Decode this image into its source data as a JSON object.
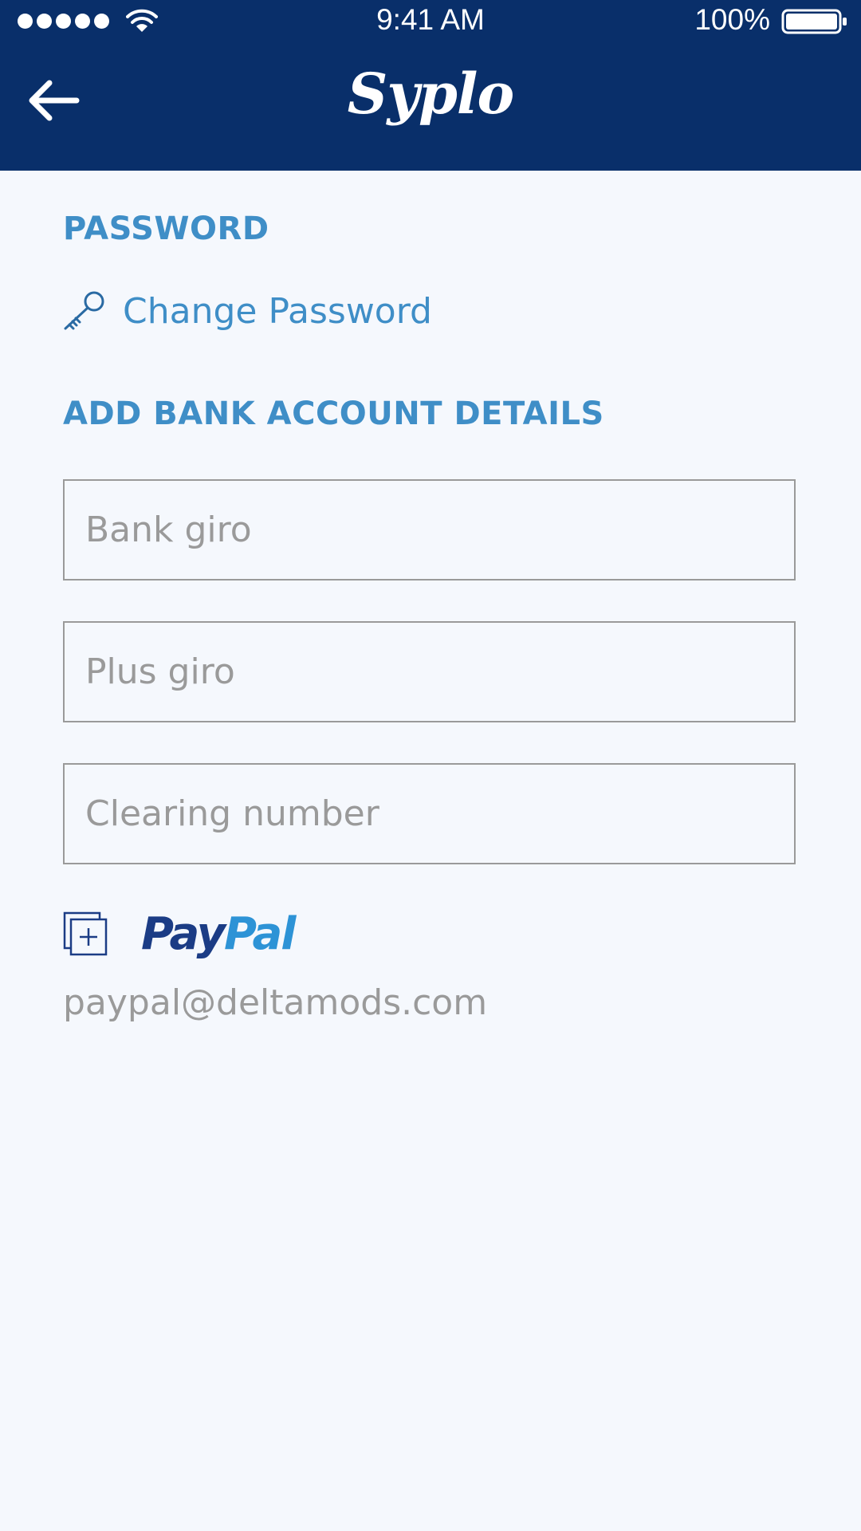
{
  "status_bar": {
    "time": "9:41 AM",
    "battery_percent": "100%",
    "signal_bars": 5,
    "wifi_icon": "wifi-icon",
    "battery_icon": "battery-full-icon"
  },
  "header": {
    "title": "Syplo",
    "back_icon": "arrow-left-icon",
    "background": "#092f6a"
  },
  "password_section": {
    "heading": "PASSWORD",
    "change_password_label": "Change Password",
    "icon": "key-icon"
  },
  "bank_section": {
    "heading": "ADD BANK ACCOUNT DETAILS",
    "fields": [
      {
        "placeholder": "Bank giro",
        "value": ""
      },
      {
        "placeholder": "Plus giro",
        "value": ""
      },
      {
        "placeholder": "Clearing number",
        "value": ""
      }
    ]
  },
  "paypal": {
    "add_icon": "add-copy-icon",
    "logo_part1": "Pay",
    "logo_part2": "Pal",
    "email": "paypal@deltamods.com"
  },
  "colors": {
    "accent": "#3f8ec7",
    "header": "#092f6a",
    "background": "#f5f8fd",
    "muted_text": "#9a9a9a",
    "paypal_dark": "#1b3c85",
    "paypal_light": "#2d93d6"
  }
}
